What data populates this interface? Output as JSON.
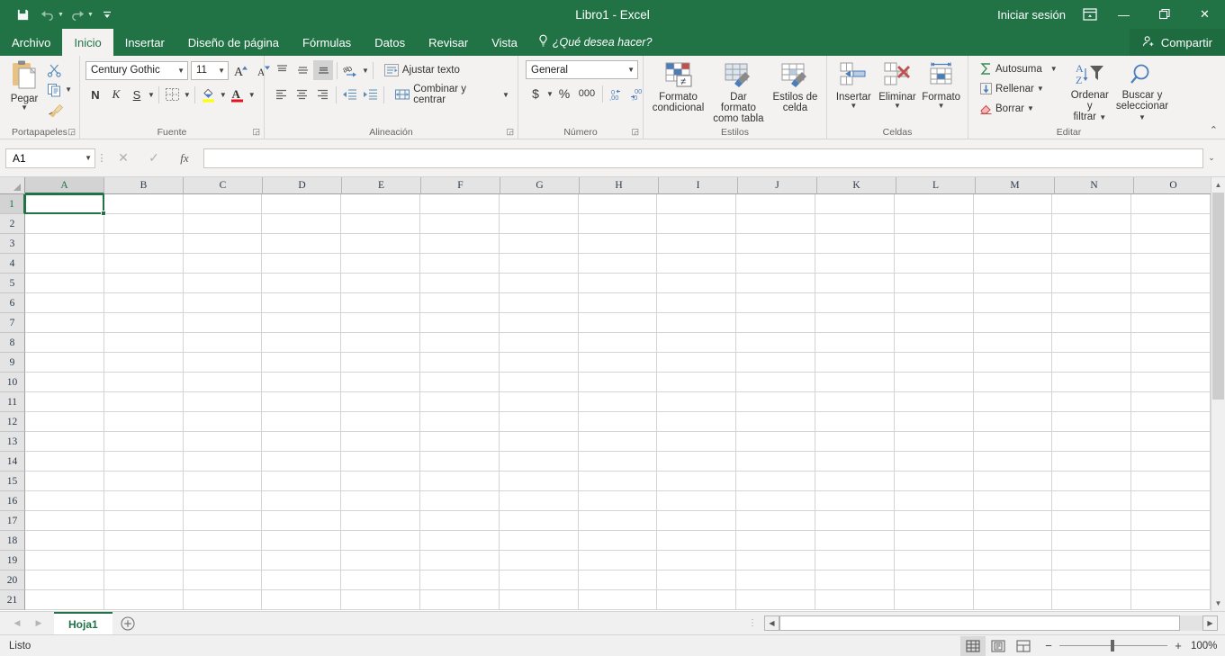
{
  "titlebar": {
    "title": "Libro1 - Excel",
    "signin": "Iniciar sesión",
    "qat": [
      {
        "name": "save-icon",
        "glyph": "save"
      },
      {
        "name": "undo-icon",
        "glyph": "undo"
      },
      {
        "name": "redo-icon",
        "glyph": "redo"
      },
      {
        "name": "customize-qat-icon",
        "glyph": "caret"
      }
    ],
    "ribbon_display_options": "ribbon-display-icon",
    "minimize": "—",
    "restore": "❐",
    "close": "✕"
  },
  "tabs": [
    {
      "label": "Archivo",
      "name": "tab-archivo",
      "active": false
    },
    {
      "label": "Inicio",
      "name": "tab-inicio",
      "active": true
    },
    {
      "label": "Insertar",
      "name": "tab-insertar",
      "active": false
    },
    {
      "label": "Diseño de página",
      "name": "tab-diseno-de-pagina",
      "active": false
    },
    {
      "label": "Fórmulas",
      "name": "tab-formulas",
      "active": false
    },
    {
      "label": "Datos",
      "name": "tab-datos",
      "active": false
    },
    {
      "label": "Revisar",
      "name": "tab-revisar",
      "active": false
    },
    {
      "label": "Vista",
      "name": "tab-vista",
      "active": false
    }
  ],
  "tellme": "¿Qué desea hacer?",
  "share": "Compartir",
  "ribbon": {
    "groups": {
      "portapapeles": {
        "label": "Portapapeles",
        "paste": "Pegar",
        "cut": "Cortar",
        "copy": "Copiar",
        "format_painter": "Copiar formato"
      },
      "fuente": {
        "label": "Fuente",
        "font_name": "Century Gothic",
        "font_size": "11",
        "grow_font": "A",
        "shrink_font": "A",
        "bold": "N",
        "italic": "K",
        "underline": "S",
        "borders": "Bordes",
        "fill_color": "Color de relleno",
        "font_color": "Color de fuente"
      },
      "alineacion": {
        "label": "Alineación",
        "wrap_text": "Ajustar texto",
        "merge_center": "Combinar y centrar",
        "align_top": "Alinear en la parte superior",
        "align_middle": "Alinear en el medio",
        "align_bottom": "Alinear en la parte inferior",
        "orientation": "Orientación",
        "align_left": "Alinear a la izquierda",
        "align_center": "Centrar",
        "align_right": "Alinear a la derecha",
        "decrease_indent": "Disminuir sangría",
        "increase_indent": "Aumentar sangría"
      },
      "numero": {
        "label": "Número",
        "format": "General",
        "currency": "$",
        "percent": "%",
        "comma": "000",
        "increase_decimal": "Aumentar decimales",
        "decrease_decimal": "Disminuir decimales"
      },
      "estilos": {
        "label": "Estilos",
        "conditional": "Formato\ncondicional",
        "conditional_l1": "Formato",
        "conditional_l2": "condicional",
        "table_l1": "Dar formato",
        "table_l2": "como tabla",
        "cellstyles_l1": "Estilos de",
        "cellstyles_l2": "celda"
      },
      "celdas": {
        "label": "Celdas",
        "insert": "Insertar",
        "delete": "Eliminar",
        "format": "Formato"
      },
      "editar": {
        "label": "Editar",
        "autosum": "Autosuma",
        "fill": "Rellenar",
        "clear": "Borrar",
        "sort_l1": "Ordenar y",
        "sort_l2": "filtrar",
        "find_l1": "Buscar y",
        "find_l2": "seleccionar",
        "collapse_ribbon": "Contraer la cinta de opciones"
      }
    }
  },
  "formulabar": {
    "namebox": "A1",
    "cancel": "✕",
    "enter": "✓",
    "insert_function": "fx",
    "formula_value": "",
    "expand": "⌄"
  },
  "grid": {
    "columns": [
      "A",
      "B",
      "C",
      "D",
      "E",
      "F",
      "G",
      "H",
      "I",
      "J",
      "K",
      "L",
      "M",
      "N",
      "O"
    ],
    "rows": [
      1,
      2,
      3,
      4,
      5,
      6,
      7,
      8,
      9,
      10,
      11,
      12,
      13,
      14,
      15,
      16,
      17,
      18,
      19,
      20,
      21
    ],
    "selected_cell": "A1",
    "selected_col": "A",
    "selected_row": 1
  },
  "sheettabs": {
    "prev": "◀",
    "next": "▶",
    "sheets": [
      {
        "label": "Hoja1",
        "active": true
      }
    ],
    "add": "✛"
  },
  "statusbar": {
    "status": "Listo",
    "views": [
      {
        "name": "normal-view-button",
        "active": true
      },
      {
        "name": "page-layout-view-button",
        "active": false
      },
      {
        "name": "page-break-view-button",
        "active": false
      }
    ],
    "zoom_out": "−",
    "zoom_in": "+",
    "zoom": "100%"
  },
  "colors": {
    "brand_green": "#217346",
    "ribbon_bg": "#f3f2f1",
    "selection_green": "#217346"
  }
}
